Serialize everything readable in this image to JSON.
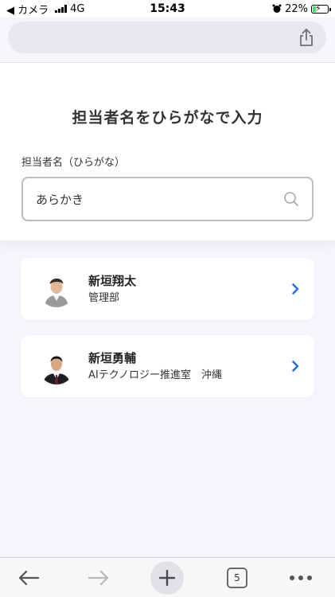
{
  "status_bar": {
    "back_label": "◀ カメラ",
    "network": "4G",
    "time": "15:43",
    "battery": "22%",
    "battery_level": 0.22
  },
  "page": {
    "title": "担当者名をひらがなで入力",
    "field_label": "担当者名（ひらがな）",
    "search_value": "あらかき"
  },
  "results": [
    {
      "name": "新垣翔太",
      "department": "管理部"
    },
    {
      "name": "新垣勇輔",
      "department": "AIテクノロジー推進室　沖縄"
    }
  ],
  "bottom_nav": {
    "tab_count": "5"
  },
  "colors": {
    "accent": "#2a6ee0",
    "background": "#f4f6fb"
  }
}
